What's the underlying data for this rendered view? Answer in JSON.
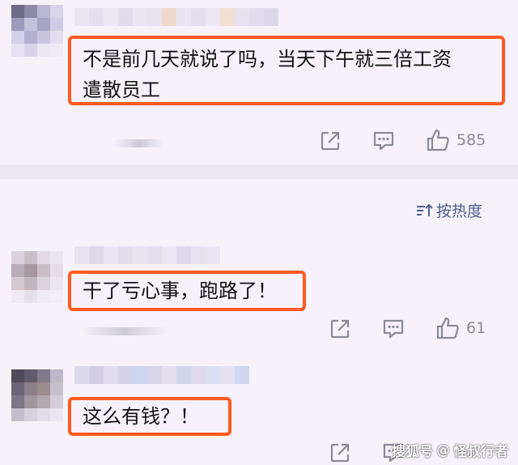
{
  "comments": [
    {
      "text": "不是前几天就说了吗，当天下午就三倍工资\n遣散员工",
      "likes": "585",
      "accent": "#ff5a1f"
    },
    {
      "text": "干了亏心事，跑路了！",
      "likes": "61",
      "accent": "#ff5a1f"
    },
    {
      "text": "这么有钱？！",
      "likes": "",
      "accent": "#ff5a1f"
    }
  ],
  "sort": {
    "label": "按热度",
    "icon": "sort-icon",
    "color": "#4a5f8c"
  },
  "icons": {
    "share": "share-icon",
    "reply": "comment-icon",
    "like": "thumbs-up-icon"
  },
  "watermark": {
    "platform": "搜狐号",
    "author": "怪叔行者"
  }
}
